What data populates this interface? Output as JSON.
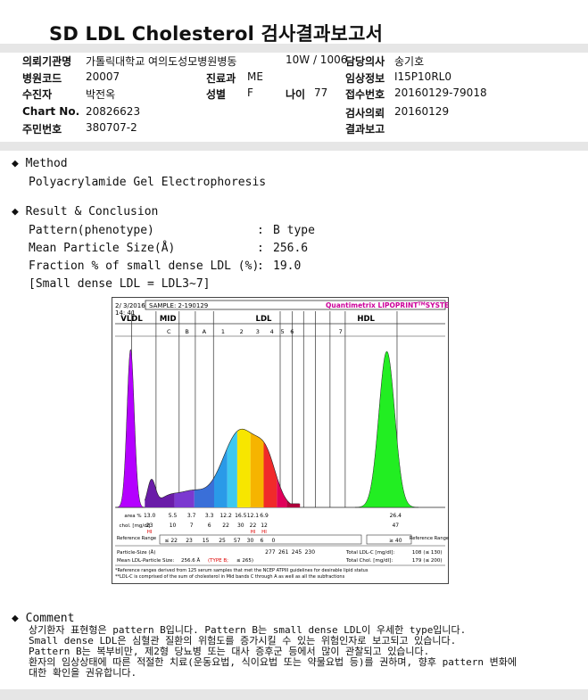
{
  "title": "SD LDL Cholesterol 검사결과보고서",
  "info": {
    "institution_label": "의뢰기관명",
    "institution": "가톨릭대학교 여의도성모병원",
    "ward_label": "병동",
    "ward": "10W / 1006",
    "doctor_label": "담당의사",
    "doctor": "송기호",
    "hospital_code_label": "병원코드",
    "hospital_code": "20007",
    "dept_label": "진료과",
    "dept": "ME",
    "clinical_info_label": "임상정보",
    "clinical_info": "I15P10RL0",
    "patient_label": "수진자",
    "patient": "박전옥",
    "sex_label": "성별",
    "sex": "F",
    "age_label": "나이",
    "age": "77",
    "receipt_no_label": "접수번호",
    "receipt_no": "20160129-79018",
    "chart_no_label": "Chart No.",
    "chart_no": "20826623",
    "request_date_label": "검사의뢰",
    "request_date": "20160129",
    "resident_no_label": "주민번호",
    "resident_no": "380707-2",
    "report_label": "결과보고"
  },
  "method": {
    "heading": "Method",
    "text": "Polyacrylamide Gel Electrophoresis"
  },
  "result": {
    "heading": "Result & Conclusion",
    "rows": [
      {
        "label": "Pattern(phenotype)",
        "colon": ":",
        "value": "B type"
      },
      {
        "label": "Mean Particle Size(Å)",
        "colon": ":",
        "value": "256.6"
      },
      {
        "label": "Fraction % of small dense LDL (%)",
        "colon": ":",
        "value": "19.0"
      }
    ],
    "note": "[Small dense LDL = LDL3~7]"
  },
  "chart_data": {
    "type": "area",
    "header": {
      "date": "2/ 3/2016",
      "time": "14: 41",
      "sample": "SAMPLE:   2-190129",
      "brand": "Quantimetrix LIPOPRINT",
      "brand_sup": "TM",
      "brand_suffix": "SYSTEM"
    },
    "group_labels": [
      "VLDL",
      "MID",
      "LDL",
      "HDL"
    ],
    "band_labels": [
      "C",
      "B",
      "A",
      "1",
      "2",
      "3",
      "4",
      "5",
      "6",
      "7"
    ],
    "band_colors": [
      "#6a1ca8",
      "#7b39d0",
      "#2a7ae2",
      "#3ec8f0",
      "#f7e600",
      "#f6b400",
      "#f02a2a",
      "#e0005a",
      "#b0003c",
      "#8e1b4a"
    ],
    "peaks": [
      {
        "name": "VLDL",
        "center": 0.047,
        "width": 0.011,
        "height": 0.86,
        "color": "#b400ff"
      },
      {
        "name": "HDL",
        "center": 0.823,
        "width": 0.024,
        "height": 0.85,
        "color": "#22ee22"
      }
    ],
    "table": {
      "area_label": "area %",
      "area_values": [
        "13.0",
        "5.5",
        "3.7",
        "3.3",
        "12.2",
        "16.5",
        "12.1",
        "6.9",
        "26.4"
      ],
      "chol_label": "chol. [mg/dl]",
      "chol_values": [
        "23",
        "10",
        "7",
        "6",
        "22",
        "30",
        "22",
        "12",
        "47"
      ],
      "chol_flags": [
        "HI",
        "",
        "",
        "",
        "",
        "",
        "HI",
        "HI",
        ""
      ],
      "ref_label": "Reference Range",
      "ref_values": [
        "≤ 22",
        "23",
        "15",
        "25",
        "57",
        "30",
        "6",
        "0",
        "≥ 40"
      ],
      "ref_right_label": "Reference Range",
      "particle_label": "Particle-Size (Å)",
      "particle_values": [
        "277",
        "261",
        "245",
        "230"
      ],
      "mean_label": "Mean LDL-Particle Size:",
      "mean_value": "256.6 Å",
      "mean_type": "(TYPE B;",
      "mean_limit": "≤ 265)",
      "total_ldl_label": "Total LDL-C [mg/dl]:",
      "total_ldl": "108",
      "total_ldl_ref": "(≤ 130)",
      "total_chol_label": "Total Chol. [mg/dl]:",
      "total_chol": "179",
      "total_chol_ref": "(≤ 200)"
    },
    "footnotes": [
      "*Reference ranges derived from 125 serum samples that met the NCEP ATPIII guidelines for desirable lipid status",
      "**LDL-C is comprised of the sum of cholesterol in Mid bands C through A as well as all the subfractions"
    ]
  },
  "comment": {
    "heading": "Comment",
    "lines": [
      "상기환자 표현형은 pattern B입니다. Pattern B는 small dense LDL이 우세한 type입니다.",
      "Small dense LDL은 심혈관 질환의 위험도를 증가시킬 수 있는 위험인자로 보고되고 있습니다.",
      "Pattern B는 복부비만, 제2형 당뇨병 또는 대사 증후군 등에서 많이 관찰되고 있습니다.",
      "환자의 임상상태에 따른 적절한 치료(운동요법, 식이요법 또는 약물요법 등)를 권하며, 향후 pattern 변화에",
      "대한 확인을 권유합니다."
    ]
  },
  "bullet_icon": "diamond-bullet-icon"
}
